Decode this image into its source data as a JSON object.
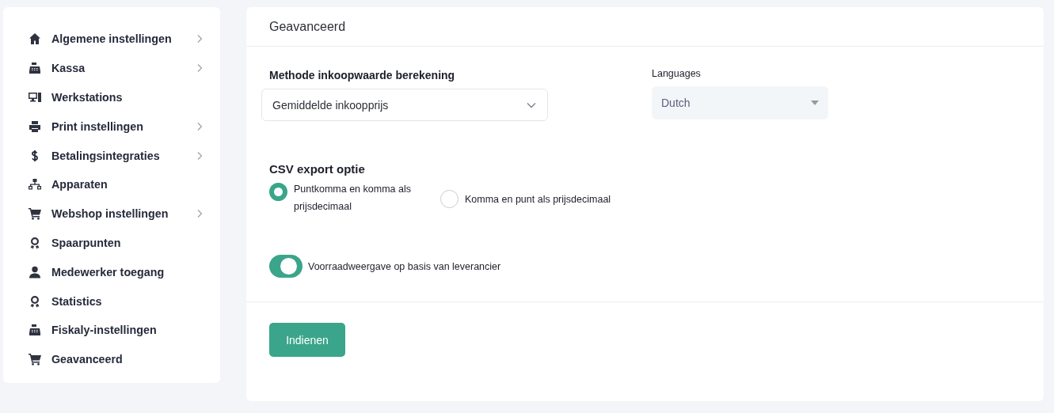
{
  "sidebar": {
    "items": [
      {
        "label": "Algemene instellingen",
        "has_submenu": true,
        "selected": false
      },
      {
        "label": "Kassa",
        "has_submenu": true,
        "selected": false
      },
      {
        "label": "Werkstations",
        "has_submenu": false,
        "selected": false
      },
      {
        "label": "Print instellingen",
        "has_submenu": true,
        "selected": false
      },
      {
        "label": "Betalingsintegraties",
        "has_submenu": true,
        "selected": false
      },
      {
        "label": "Apparaten",
        "has_submenu": false,
        "selected": false
      },
      {
        "label": "Webshop instellingen",
        "has_submenu": true,
        "selected": false
      },
      {
        "label": "Spaarpunten",
        "has_submenu": false,
        "selected": false
      },
      {
        "label": "Medewerker toegang",
        "has_submenu": false,
        "selected": false
      },
      {
        "label": "Statistics",
        "has_submenu": false,
        "selected": false
      },
      {
        "label": "Fiskaly-instellingen",
        "has_submenu": false,
        "selected": false
      },
      {
        "label": "Geavanceerd",
        "has_submenu": false,
        "selected": false
      }
    ]
  },
  "panel": {
    "title": "Geavanceerd",
    "method": {
      "label": "Methode inkoopwaarde berekening",
      "value": "Gemiddelde inkoopprijs"
    },
    "languages": {
      "label": "Languages",
      "value": "Dutch"
    },
    "csv": {
      "heading": "CSV export optie",
      "options": [
        {
          "label": "Puntkomma en komma als prijsdecimaal",
          "selected": true
        },
        {
          "label": "Komma en punt als prijsdecimaal",
          "selected": false
        }
      ]
    },
    "stock_toggle": {
      "label": "Voorraadweergave op basis van leverancier",
      "on": true
    },
    "submit": "Indienen"
  }
}
